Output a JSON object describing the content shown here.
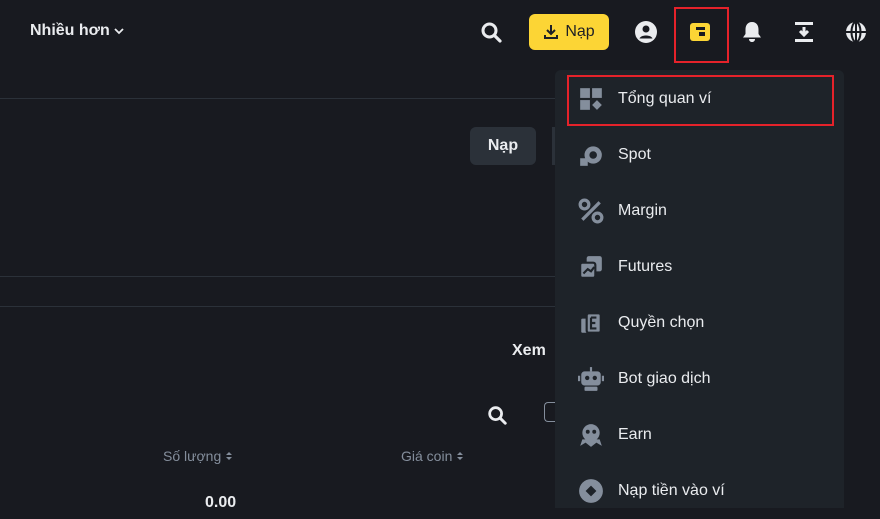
{
  "topbar": {
    "more_label": "Nhiều hơn",
    "deposit_label": "Nạp",
    "icons": [
      "search-icon",
      "download-icon",
      "user-icon",
      "wallet-icon",
      "bell-icon",
      "transfer-icon",
      "globe-icon"
    ]
  },
  "main": {
    "deposit_button": "Nạp",
    "view_label": "Xem",
    "columns": [
      "Số lượng",
      "Giá coin"
    ],
    "amount_value": "0.00"
  },
  "wallet_menu": {
    "items": [
      {
        "label": "Tổng quan ví",
        "icon": "overview-grid-icon"
      },
      {
        "label": "Spot",
        "icon": "spot-icon"
      },
      {
        "label": "Margin",
        "icon": "percent-icon"
      },
      {
        "label": "Futures",
        "icon": "futures-icon"
      },
      {
        "label": "Quyền chọn",
        "icon": "options-icon"
      },
      {
        "label": "Bot giao dịch",
        "icon": "robot-icon"
      },
      {
        "label": "Earn",
        "icon": "earn-icon"
      },
      {
        "label": "Nạp tiền vào ví",
        "icon": "fund-icon"
      }
    ]
  },
  "colors": {
    "background": "#181a20",
    "accent": "#fcd535",
    "menu_bg": "#1e2329",
    "highlight": "#e5222a",
    "muted_text": "#848e9c"
  }
}
